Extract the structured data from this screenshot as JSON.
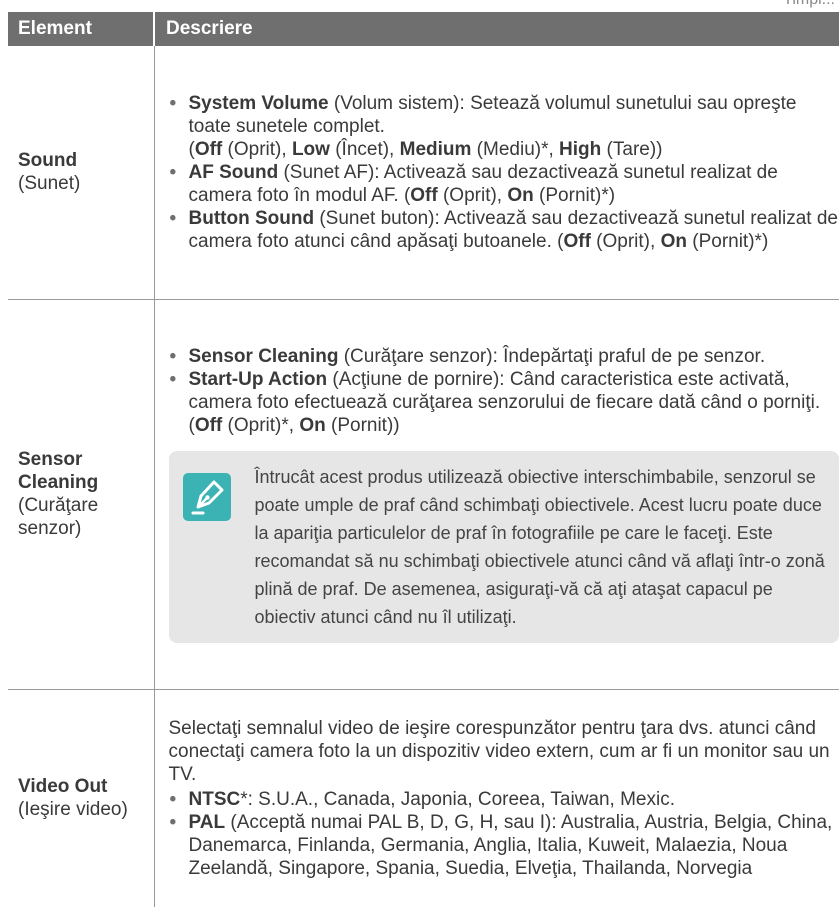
{
  "page": {
    "top_note": "Timpl..."
  },
  "header": {
    "col_element": "Element",
    "col_description": "Descriere"
  },
  "rows": [
    {
      "name": "Sound",
      "translation": "(Sunet)",
      "items": [
        {
          "term": "System Volume",
          "text": " (Volum sistem): Setează volumul sunetului sau opreşte toate sunetele complet.",
          "options": [
            {
              "opt": "Off",
              "tr": " (Oprit), "
            },
            {
              "opt": "Low",
              "tr": " (Încet), "
            },
            {
              "opt": "Medium",
              "tr": " (Mediu)*, "
            },
            {
              "opt": "High",
              "tr": " (Tare)"
            }
          ]
        },
        {
          "term": "AF Sound",
          "text": " (Sunet AF): Activează sau dezactivează sunetul realizat de camera foto în modul AF. (",
          "options": [
            {
              "opt": "Off",
              "tr": " (Oprit), "
            },
            {
              "opt": "On",
              "tr": " (Pornit)*"
            }
          ],
          "close": ")"
        },
        {
          "term": "Button Sound",
          "text": " (Sunet buton): Activează sau dezactivează sunetul realizat de camera foto atunci când apăsaţi butoanele. (",
          "options": [
            {
              "opt": "Off",
              "tr": " (Oprit), "
            },
            {
              "opt": "On",
              "tr": " (Pornit)*"
            }
          ],
          "close": ")"
        }
      ]
    },
    {
      "name_line1": "Sensor",
      "name_line2": "Cleaning",
      "translation": "(Curăţare senzor)",
      "items": [
        {
          "term": "Sensor Cleaning",
          "text": " (Curăţare senzor): Îndepărtaţi praful de pe senzor."
        },
        {
          "term": "Start-Up Action",
          "text": " (Acţiune de pornire): Când caracteristica este activată, camera foto efectuează curăţarea senzorului de fiecare dată când o porniţi. (",
          "options": [
            {
              "opt": "Off",
              "tr": " (Oprit)*, "
            },
            {
              "opt": "On",
              "tr": " (Pornit)"
            }
          ],
          "close": ")"
        }
      ],
      "note": "Întrucât acest produs utilizează obiective interschimbabile, senzorul se poate umple de praf când schimbaţi obiectivele. Acest lucru poate duce la apariţia particulelor de praf în fotografiile pe care le faceţi. Este recomandat să nu schimbaţi obiectivele atunci când vă aflaţi într-o zonă plină de praf. De asemenea, asiguraţi-vă că aţi ataşat capacul pe obiectiv atunci când nu îl utilizaţi.",
      "note_icon": "pen-nib-note-icon",
      "note_icon_color": "#3bb3b5"
    },
    {
      "name": "Video Out",
      "translation": "(Ieşire video)",
      "intro": "Selectaţi semnalul video de ieşire corespunzător pentru ţara dvs. atunci când conectaţi camera foto la un dispozitiv video extern, cum ar fi un monitor sau un TV.",
      "items": [
        {
          "term": "NTSC",
          "text": "*: S.U.A., Canada, Japonia, Coreea, Taiwan, Mexic."
        },
        {
          "term": "PAL",
          "text": " (Acceptă numai PAL B, D, G, H, sau I): Australia, Austria, Belgia, China, Danemarca, Finlanda, Germania, Anglia, Italia, Kuweit, Malaezia, Noua Zeelandă, Singapore, Spania, Suedia, Elveţia, Thailanda, Norvegia"
        }
      ]
    }
  ],
  "colors": {
    "header_bg": "#6f6f6f",
    "note_bg": "#e6e6e6",
    "accent": "#3bb3b5"
  }
}
